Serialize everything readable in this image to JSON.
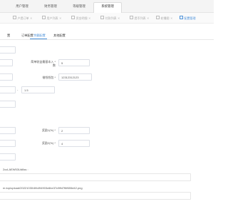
{
  "top_nav": {
    "tabs": [
      {
        "label": "用户管理"
      },
      {
        "label": "财务管理"
      },
      {
        "label": "等级管理"
      },
      {
        "label": "系统管理"
      }
    ],
    "active_index": 3
  },
  "sub_nav": {
    "items": [
      {
        "label": "户提订单"
      },
      {
        "label": "用户列表"
      },
      {
        "label": "资金明细"
      },
      {
        "label": "付款列表"
      },
      {
        "label": "提币列表"
      },
      {
        "label": "轮播图"
      },
      {
        "label": "配置管理"
      }
    ],
    "active_index": 6,
    "close_glyph": "✕"
  },
  "settings_tabs": {
    "tabs": [
      {
        "label": "置"
      },
      {
        "label": "订单配置"
      },
      {
        "label": "余额配置"
      },
      {
        "label": "其他配置"
      }
    ],
    "active_index": 2
  },
  "form": {
    "min_withdraw_label_line1": "简单收益最基本入 *",
    "min_withdraw_label_line2": "数",
    "min_withdraw_value": "5",
    "recharge_wallet_label": "借钱钱包 *",
    "recharge_wallet_value": "12312312123",
    "rate_separator": "-",
    "rate_value": "1.5",
    "reward1_label": "奖励1(%) *",
    "reward1_value": "2",
    "reward2_label": "奖励2(%) *",
    "reward2_value": "4",
    "address_partial": "2ccLAEW53Ud6ss",
    "address_suffix": ":",
    "image_url": "m.top/upload/20221030/4fb494903c6be37c9ffd7f6f655d42.png"
  },
  "colors": {
    "accent": "#4a90d9",
    "border": "#dcdfe6",
    "nav_bg": "#f4f4f4"
  }
}
